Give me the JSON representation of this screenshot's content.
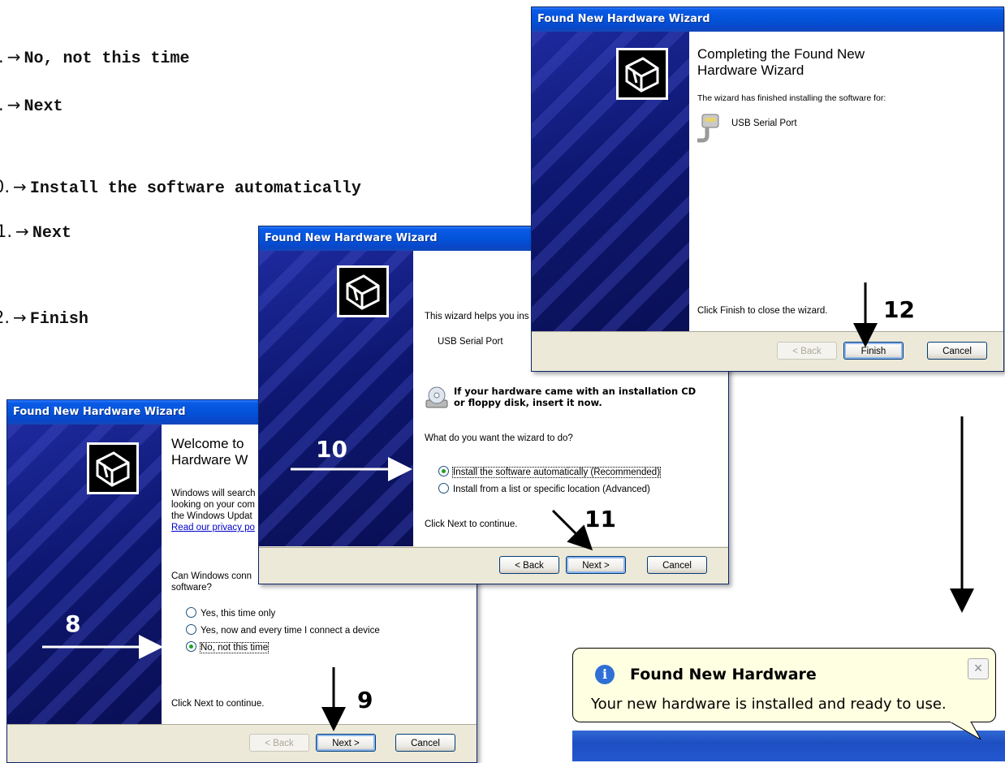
{
  "steps": [
    {
      "num": ".",
      "text": "No, not this time"
    },
    {
      "num": ".",
      "text": "Next"
    },
    {
      "num": "0.",
      "text": "Install the software automatically"
    },
    {
      "num": "1.",
      "text": "Next"
    },
    {
      "num": "2.",
      "text": "Finish"
    }
  ],
  "annotations": {
    "a8": "8",
    "a9": "9",
    "a10": "10",
    "a11": "11",
    "a12": "12"
  },
  "win_welcome": {
    "title": "Found New Hardware Wizard",
    "heading": "Welcome to\nHardware W",
    "body_lines": [
      "Windows will search",
      "looking on your com",
      "the Windows Updat"
    ],
    "privacy_link": "Read our privacy po",
    "question": "Can Windows conn\nsoftware?",
    "options": [
      "Yes, this time only",
      "Yes, now and every time I connect a device",
      "No, not this time"
    ],
    "selected_index": 2,
    "hint": "Click Next to continue.",
    "back": "< Back",
    "next": "Next >",
    "cancel": "Cancel"
  },
  "win_install": {
    "title": "Found New Hardware Wizard",
    "intro": "This wizard helps you ins",
    "device": "USB Serial Port",
    "cd_text": "If your hardware came with an installation CD\nor floppy disk, insert it now.",
    "question": "What do you want the wizard to do?",
    "options": [
      "Install the software automatically (Recommended)",
      "Install from a list or specific location (Advanced)"
    ],
    "selected_index": 0,
    "hint": "Click Next to continue.",
    "back": "< Back",
    "next": "Next >",
    "cancel": "Cancel"
  },
  "win_complete": {
    "title": "Found New Hardware Wizard",
    "heading": "Completing the Found New\nHardware Wizard",
    "finished_text": "The wizard has finished installing the software for:",
    "device": "USB Serial Port",
    "hint": "Click Finish to close the wizard.",
    "back": "< Back",
    "finish": "Finish",
    "cancel": "Cancel"
  },
  "balloon": {
    "title": "Found New Hardware",
    "message": "Your new hardware is installed and ready to use.",
    "close": "×"
  },
  "icons": [
    "right-arrow-icon",
    "hardware-wizard-icon",
    "serial-port-icon",
    "cd-drive-icon",
    "info-icon",
    "close-icon"
  ]
}
